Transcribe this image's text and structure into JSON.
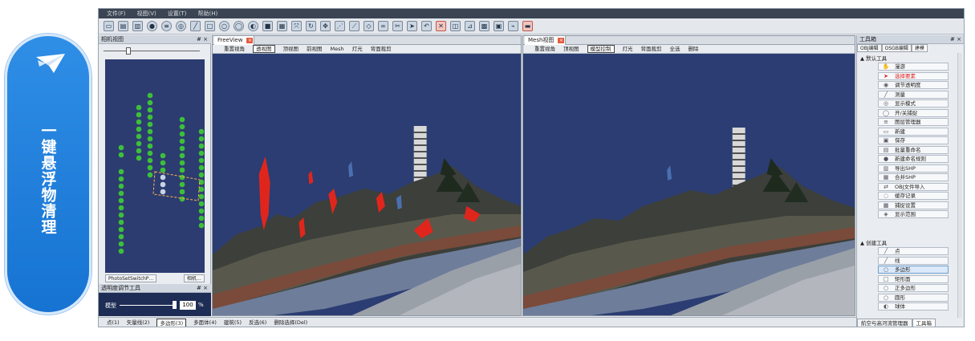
{
  "banner": {
    "title": "一键悬浮物清理",
    "icon": "paper-plane-icon",
    "color": "#1f80dd"
  },
  "menubar": [
    "文件(F)",
    "视图(V)",
    "设置(T)",
    "帮助(H)"
  ],
  "camera_panel": {
    "title": "相机视图",
    "pin": "# ×",
    "tabs": [
      "PhotoSetSwitchP…",
      "相机…"
    ]
  },
  "transparency_panel": {
    "title": "透明度调节工具",
    "pin": "# ×",
    "label": "模型",
    "value": "100",
    "unit": "%"
  },
  "left_view": {
    "tab": "FreeView",
    "close": "×",
    "menu": [
      "重置视角",
      "透视图",
      "顶视图",
      "前视图",
      "Mesh",
      "灯光",
      "背面裁剪"
    ],
    "selected": "透视图"
  },
  "right_view": {
    "tab": "Mesh视图",
    "close": "×",
    "menu": [
      "重置视角",
      "顶视图",
      "模型控制",
      "灯光",
      "背面裁剪",
      "全选",
      "删除"
    ],
    "selected": "模型控制"
  },
  "toolbox": {
    "title": "工具箱",
    "pin": "# ×",
    "tabs": [
      "OBJ编辑",
      "OSGB编辑",
      "建模"
    ],
    "active_tab": "建模",
    "group_default": "▲ 默认工具",
    "group_create": "▲ 创建工具",
    "default_tools": [
      {
        "label": "漫游",
        "icon": "hand-icon",
        "red": false
      },
      {
        "label": "选择要素",
        "icon": "cursor-icon",
        "red": true
      },
      {
        "label": "调节透明度",
        "icon": "palette-icon",
        "red": false
      },
      {
        "label": "测量",
        "icon": "ruler-icon",
        "red": false
      },
      {
        "label": "显示模式",
        "icon": "eye-icon",
        "red": false
      },
      {
        "label": "开/关捕捉",
        "icon": "magnet-icon",
        "red": false
      },
      {
        "label": "图层管理器",
        "icon": "layers-icon",
        "red": false
      },
      {
        "label": "新建",
        "icon": "new-file-icon",
        "red": false
      },
      {
        "label": "保存",
        "icon": "save-icon",
        "red": false
      },
      {
        "label": "批量重命名",
        "icon": "rename-icon",
        "red": false
      },
      {
        "label": "新建命名规则",
        "icon": "info-icon",
        "red": false
      },
      {
        "label": "导出SHP",
        "icon": "export-icon",
        "red": false
      },
      {
        "label": "合并SHP",
        "icon": "merge-icon",
        "red": false
      },
      {
        "label": "OBJ文件导入",
        "icon": "import-icon",
        "red": false
      },
      {
        "label": "缓存记录",
        "icon": "history-icon",
        "red": false
      },
      {
        "label": "捕捉设置",
        "icon": "settings-icon",
        "red": false
      },
      {
        "label": "显示范围",
        "icon": "range-icon",
        "red": false
      }
    ],
    "create_tools": [
      {
        "label": "点",
        "icon": "point-icon"
      },
      {
        "label": "线",
        "icon": "line-icon"
      },
      {
        "label": "多边形",
        "icon": "polygon-icon"
      },
      {
        "label": "矩形面",
        "icon": "rectangle-icon"
      },
      {
        "label": "正多边形",
        "icon": "regular-polygon-icon"
      },
      {
        "label": "圆形",
        "icon": "circle-icon"
      },
      {
        "label": "球体",
        "icon": "sphere-icon"
      }
    ],
    "highlighted_create": "多边形",
    "bottom_tabs": [
      "航空与高河流管理器",
      "工具箱"
    ],
    "bottom_active": "工具箱"
  },
  "statusbar": {
    "items": [
      "点(1)",
      "矢量线(2)",
      "多边形(3)",
      "多面体(4)",
      "建筑(5)",
      "反选(6)",
      "删除选择(Del)"
    ],
    "selected": "多边形(3)"
  },
  "colors": {
    "scene_sky": "#2b3d72",
    "camera_view": "#2c3c70",
    "selection_red": "#e0261c",
    "point_green": "#3dbf3a"
  }
}
